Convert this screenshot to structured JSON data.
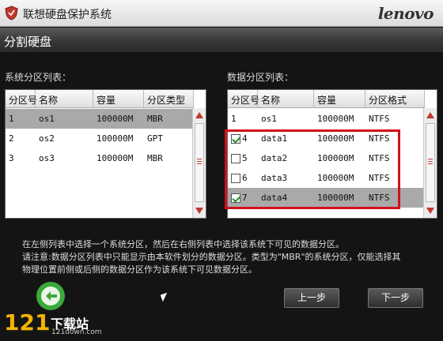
{
  "window": {
    "title": "联想硬盘保护系统",
    "brand": "lenovo"
  },
  "section": {
    "title": "分割硬盘"
  },
  "system_list": {
    "label": "系统分区列表：",
    "columns": [
      "分区号",
      "名称",
      "容量",
      "分区类型"
    ],
    "rows": [
      {
        "no": "1",
        "name": "os1",
        "size": "100000M",
        "type": "MBR",
        "selected": true
      },
      {
        "no": "2",
        "name": "os2",
        "size": "100000M",
        "type": "GPT",
        "selected": false
      },
      {
        "no": "3",
        "name": "os3",
        "size": "100000M",
        "type": "MBR",
        "selected": false
      }
    ]
  },
  "data_list": {
    "label": "数据分区列表：",
    "columns": [
      "分区号",
      "名称",
      "容量",
      "分区格式"
    ],
    "rows": [
      {
        "no": "1",
        "name": "os1",
        "size": "100000M",
        "format": "NTFS",
        "checkbox": false,
        "checked": false,
        "selected": false
      },
      {
        "no": "4",
        "name": "data1",
        "size": "100000M",
        "format": "NTFS",
        "checkbox": true,
        "checked": true,
        "selected": false
      },
      {
        "no": "5",
        "name": "data2",
        "size": "100000M",
        "format": "NTFS",
        "checkbox": true,
        "checked": false,
        "selected": false
      },
      {
        "no": "6",
        "name": "data3",
        "size": "100000M",
        "format": "NTFS",
        "checkbox": true,
        "checked": false,
        "selected": false
      },
      {
        "no": "7",
        "name": "data4",
        "size": "100000M",
        "format": "NTFS",
        "checkbox": true,
        "checked": true,
        "selected": true
      }
    ]
  },
  "info": {
    "line1": "在左侧列表中选择一个系统分区，然后在右侧列表中选择该系统下可见的数据分区。",
    "line2": "请注意:数据分区列表中只能显示由本软件划分的数据分区。类型为\"MBR\"的系统分区，仅能选择其",
    "line3": "物理位置前侧或后侧的数据分区作为该系统下可见数据分区。"
  },
  "buttons": {
    "prev": "上一步",
    "next": "下一步"
  },
  "watermark": {
    "number": "121",
    "site": "下载站",
    "url": "121down.com"
  },
  "colors": {
    "highlight": "#d2101b",
    "selected_row": "#a9a9a9",
    "accent": "#c0392b"
  }
}
